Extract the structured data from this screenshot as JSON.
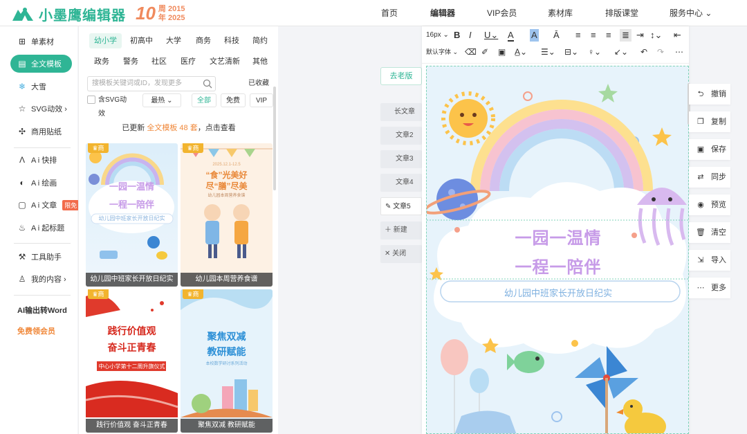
{
  "brand": {
    "name": "小墨鹰编辑器",
    "anniv_num": "10",
    "anniv_line1": "周 2015",
    "anniv_line2": "年 2025"
  },
  "nav": [
    {
      "label": "首页"
    },
    {
      "label": "编辑器"
    },
    {
      "label": "VIP会员"
    },
    {
      "label": "素材库"
    },
    {
      "label": "排版课堂"
    },
    {
      "label": "服务中心 ⌄"
    }
  ],
  "leftnav": {
    "items": [
      {
        "label": "单素材",
        "icon": "grid-icon"
      },
      {
        "label": "全文模板",
        "icon": "template-icon"
      },
      {
        "label": "大雪",
        "icon": "snow-icon"
      },
      {
        "label": "SVG动效 ›",
        "icon": "star-icon"
      },
      {
        "label": "商用贴纸",
        "icon": "puzzle-icon"
      },
      {
        "label": "A i 快排",
        "icon": "ai-icon"
      },
      {
        "label": "A i 绘画",
        "icon": "palette-icon"
      },
      {
        "label": "A i 文章",
        "icon": "doc-icon",
        "badge": "限免"
      },
      {
        "label": "A i 起标题",
        "icon": "fire-icon"
      },
      {
        "label": "工具助手",
        "icon": "tool-icon"
      },
      {
        "label": "我的内容 ›",
        "icon": "user-icon"
      },
      {
        "label": "AI输出转Word",
        "icon": ""
      },
      {
        "label": "免费领会员",
        "icon": ""
      }
    ]
  },
  "panel": {
    "categories_row1": [
      "幼小学",
      "初高中",
      "大学",
      "商务",
      "科技",
      "简约"
    ],
    "categories_row2": [
      "政务",
      "警务",
      "社区",
      "医疗",
      "文艺清新",
      "其他"
    ],
    "search_placeholder": "搜模板关键词或ID，发现更多",
    "collected": "已收藏",
    "svg_checkbox": "含SVG动效",
    "sort": "最热 ⌄",
    "filters": [
      "全部",
      "免费",
      "VIP"
    ],
    "update_pre": "已更新 ",
    "update_hl": "全文模板 48 套",
    "update_post": "，点击查看",
    "cards": [
      {
        "caption": "幼儿园中班家长开放日纪实",
        "title1": "一园一温情",
        "title2": "一程一陪伴",
        "sub": "幼儿园中班家长开放日纪实"
      },
      {
        "caption": "幼儿园本周营养食谱",
        "date": "2025.12.1-12.5",
        "title1": "“食”光美好",
        "title2": "尽“膳”尽美",
        "sub": "幼儿园本周营养食谱"
      },
      {
        "caption": "践行价值观 奋斗正青春",
        "title1": "践行价值观",
        "title2": "奋斗正青春",
        "sub": "中心小学第十二周升旗仪式"
      },
      {
        "caption": "聚焦双减 教研赋能",
        "title1": "聚焦双减",
        "title2": "教研赋能",
        "sub": "本校数学研讨系列活动"
      }
    ],
    "crown_label": "商"
  },
  "editor": {
    "old_version": "去老版",
    "doc_tabs": [
      "长文章",
      "文章2",
      "文章3",
      "文章4",
      "文章5",
      "新建",
      "关闭"
    ],
    "font_size": "16px",
    "font_family": "默认字体",
    "article": {
      "title1": "一园一温情",
      "title2": "一程一陪伴",
      "subtitle": "幼儿园中班家长开放日纪实"
    }
  },
  "side_actions": [
    "撤销",
    "复制",
    "保存",
    "同步",
    "预览",
    "清空",
    "导入",
    "更多"
  ],
  "colors": {
    "accent": "#2fb595",
    "orange": "#f0883a",
    "purple": "#c79be8"
  }
}
